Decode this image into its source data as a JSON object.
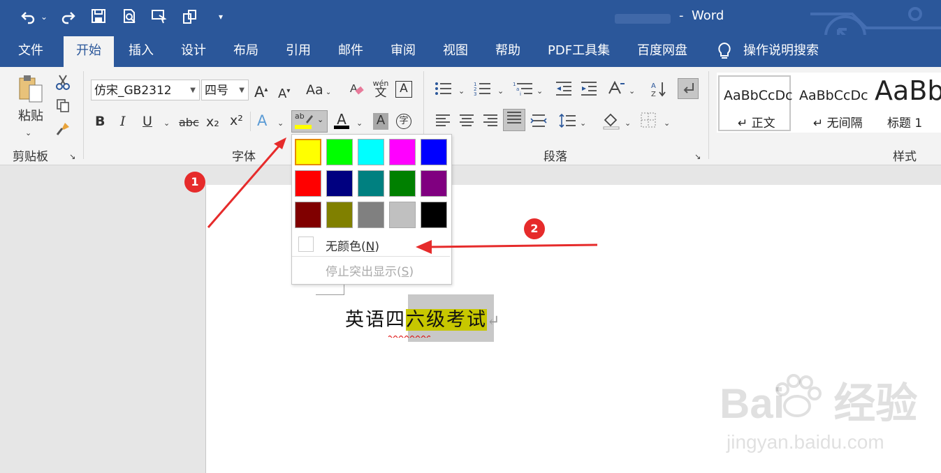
{
  "titlebar": {
    "app_name": "Word",
    "undo_icon": "undo-icon",
    "redo_icon": "redo-icon",
    "save_icon": "save-icon",
    "preview_icon": "print-preview-icon",
    "touch_icon": "touch-mode-icon",
    "customize_icon": "customize-qat-icon"
  },
  "tabs": [
    "文件",
    "开始",
    "插入",
    "设计",
    "布局",
    "引用",
    "邮件",
    "审阅",
    "视图",
    "帮助",
    "PDF工具集",
    "百度网盘"
  ],
  "active_tab": "开始",
  "tell_me": "操作说明搜索",
  "clipboard": {
    "paste_label": "粘贴",
    "group_label": "剪贴板"
  },
  "font": {
    "font_name": "仿宋_GB2312",
    "font_size": "四号",
    "group_label": "字体",
    "aa_label": "Aa",
    "wen_label": "wén",
    "wen_char": "文",
    "a_box": "A",
    "bold": "B",
    "italic": "I",
    "underline": "U",
    "strike": "abc",
    "subscript": "x₂",
    "superscript": "x²",
    "highlight_top": "ab",
    "font_color": "A",
    "shading": "A",
    "enclose": "字"
  },
  "paragraph": {
    "group_label": "段落"
  },
  "styles": {
    "group_label": "样式",
    "items": [
      {
        "preview": "AaBbCcDc",
        "name": "↵ 正文"
      },
      {
        "preview": "AaBbCcDc",
        "name": "↵ 无间隔"
      },
      {
        "preview": "AaBb",
        "name": "标题 1"
      }
    ]
  },
  "highlight_menu": {
    "colors": [
      "#ffff00",
      "#00ff00",
      "#00ffff",
      "#ff00ff",
      "#0000ff",
      "#ff0000",
      "#000080",
      "#008080",
      "#008000",
      "#800080",
      "#800000",
      "#808000",
      "#808080",
      "#c0c0c0",
      "#000000"
    ],
    "selected_color": "#ffff00",
    "no_color_label": "无颜色(",
    "no_color_key": "N",
    "no_color_close": ")",
    "stop_label": "停止突出显示(",
    "stop_key": "S",
    "stop_close": ")"
  },
  "document": {
    "text_plain": "英语四",
    "text_highlight": "六级考试",
    "paragraph_mark": "↵"
  },
  "annotations": {
    "badge1": "1",
    "badge2": "2",
    "accent_color": "#e62b2b"
  },
  "watermark": {
    "logo_text": "Bai",
    "logo_tail": "经验",
    "url": "jingyan.baidu.com"
  }
}
